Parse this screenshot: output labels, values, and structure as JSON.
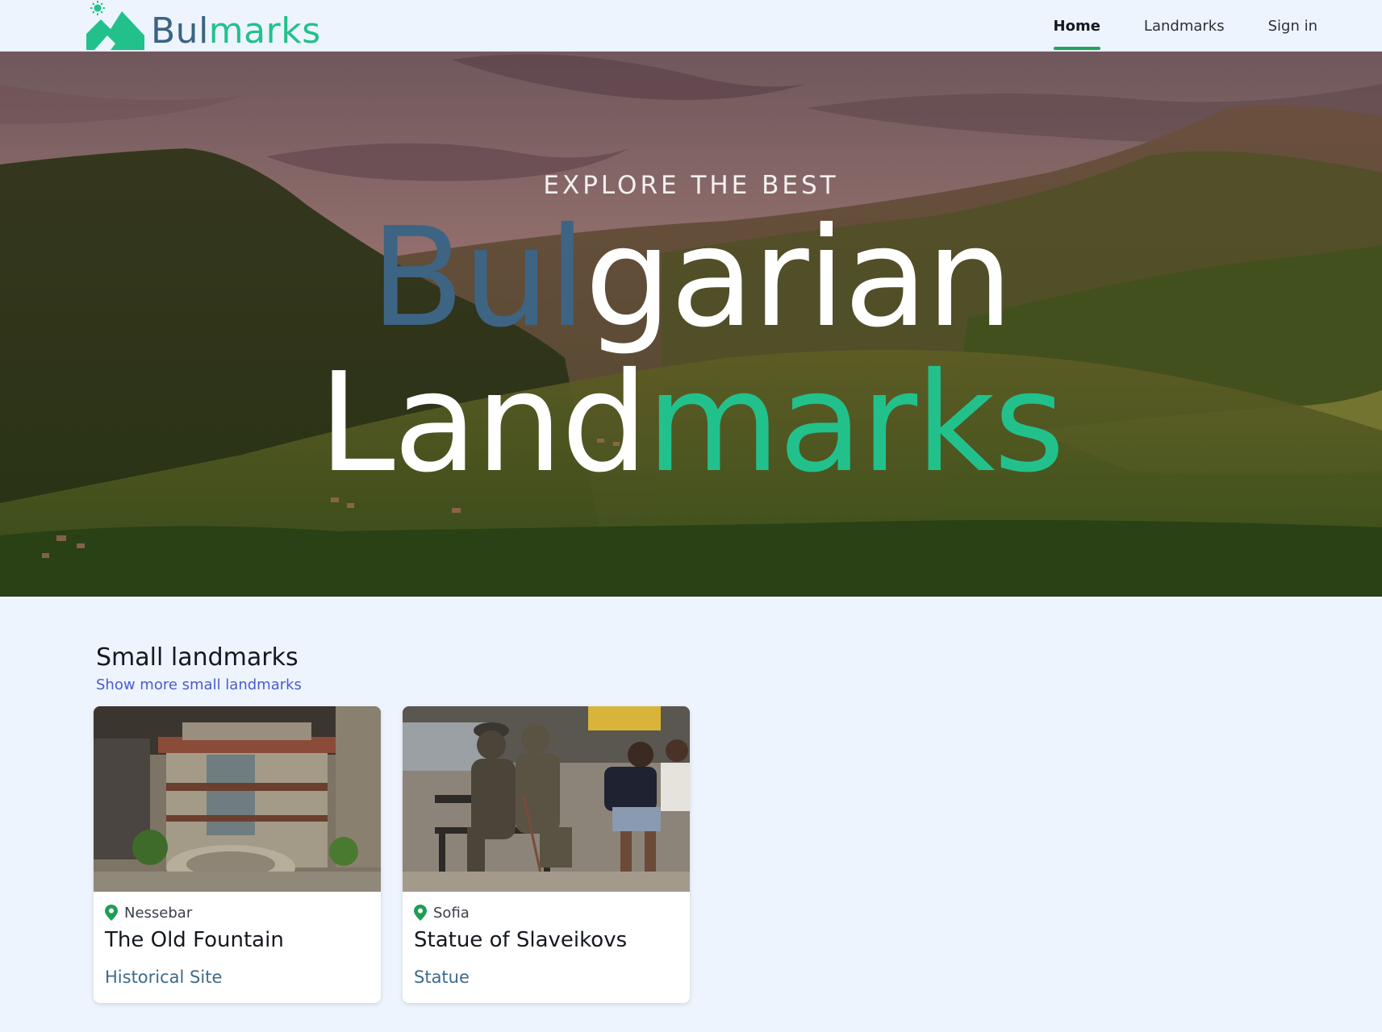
{
  "header": {
    "logo": {
      "part1": "Bul",
      "part2": "marks"
    },
    "nav": [
      {
        "label": "Home",
        "active": true
      },
      {
        "label": "Landmarks",
        "active": false
      },
      {
        "label": "Sign in",
        "active": false
      }
    ]
  },
  "hero": {
    "subtitle": "EXPLORE THE BEST",
    "line1": {
      "part1": "Bul",
      "part2": "garian"
    },
    "line2": {
      "part1": "Land",
      "part2": "marks"
    }
  },
  "small_landmarks": {
    "title": "Small landmarks",
    "link": "Show more small landmarks",
    "cards": [
      {
        "location": "Nessebar",
        "name": "The Old Fountain",
        "category": "Historical Site",
        "image": "stone-fountain-photo"
      },
      {
        "location": "Sofia",
        "name": "Statue of Slaveikovs",
        "category": "Statue",
        "image": "bronze-statue-bench-photo"
      }
    ]
  },
  "colors": {
    "brand_blue": "#3e6483",
    "brand_green": "#22c18c",
    "active_underline": "#22a35a",
    "link": "#4b5bd1",
    "pin": "#1e9e55"
  }
}
